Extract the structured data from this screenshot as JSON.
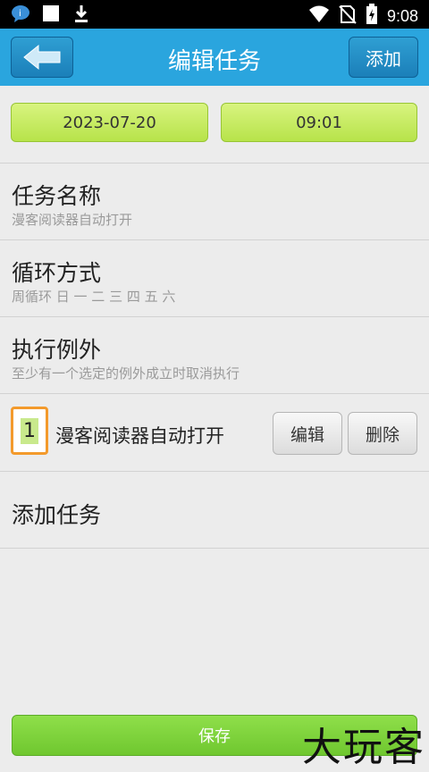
{
  "status_bar": {
    "time": "9:08",
    "icons": [
      "message-icon",
      "notification-square-icon",
      "download-icon",
      "wifi-icon",
      "no-sim-icon",
      "battery-charging-icon"
    ]
  },
  "header": {
    "title": "编辑任务",
    "add_label": "添加",
    "back_icon": "back-arrow-icon",
    "color": "#2aa5de"
  },
  "schedule": {
    "date": "2023-07-20",
    "time": "09:01"
  },
  "sections": {
    "task_name": {
      "title": "任务名称",
      "subtitle": "漫客阅读器自动打开"
    },
    "repeat": {
      "title": "循环方式",
      "subtitle": "周循环 日 一 二 三 四 五 六"
    },
    "exception": {
      "title": "执行例外",
      "subtitle": "至少有一个选定的例外成立时取消执行"
    }
  },
  "task_list": [
    {
      "index": "1",
      "name": "漫客阅读器自动打开",
      "edit_label": "编辑",
      "delete_label": "删除"
    }
  ],
  "add_task_label": "添加任务",
  "save_label": "保存",
  "watermark": "大玩客"
}
